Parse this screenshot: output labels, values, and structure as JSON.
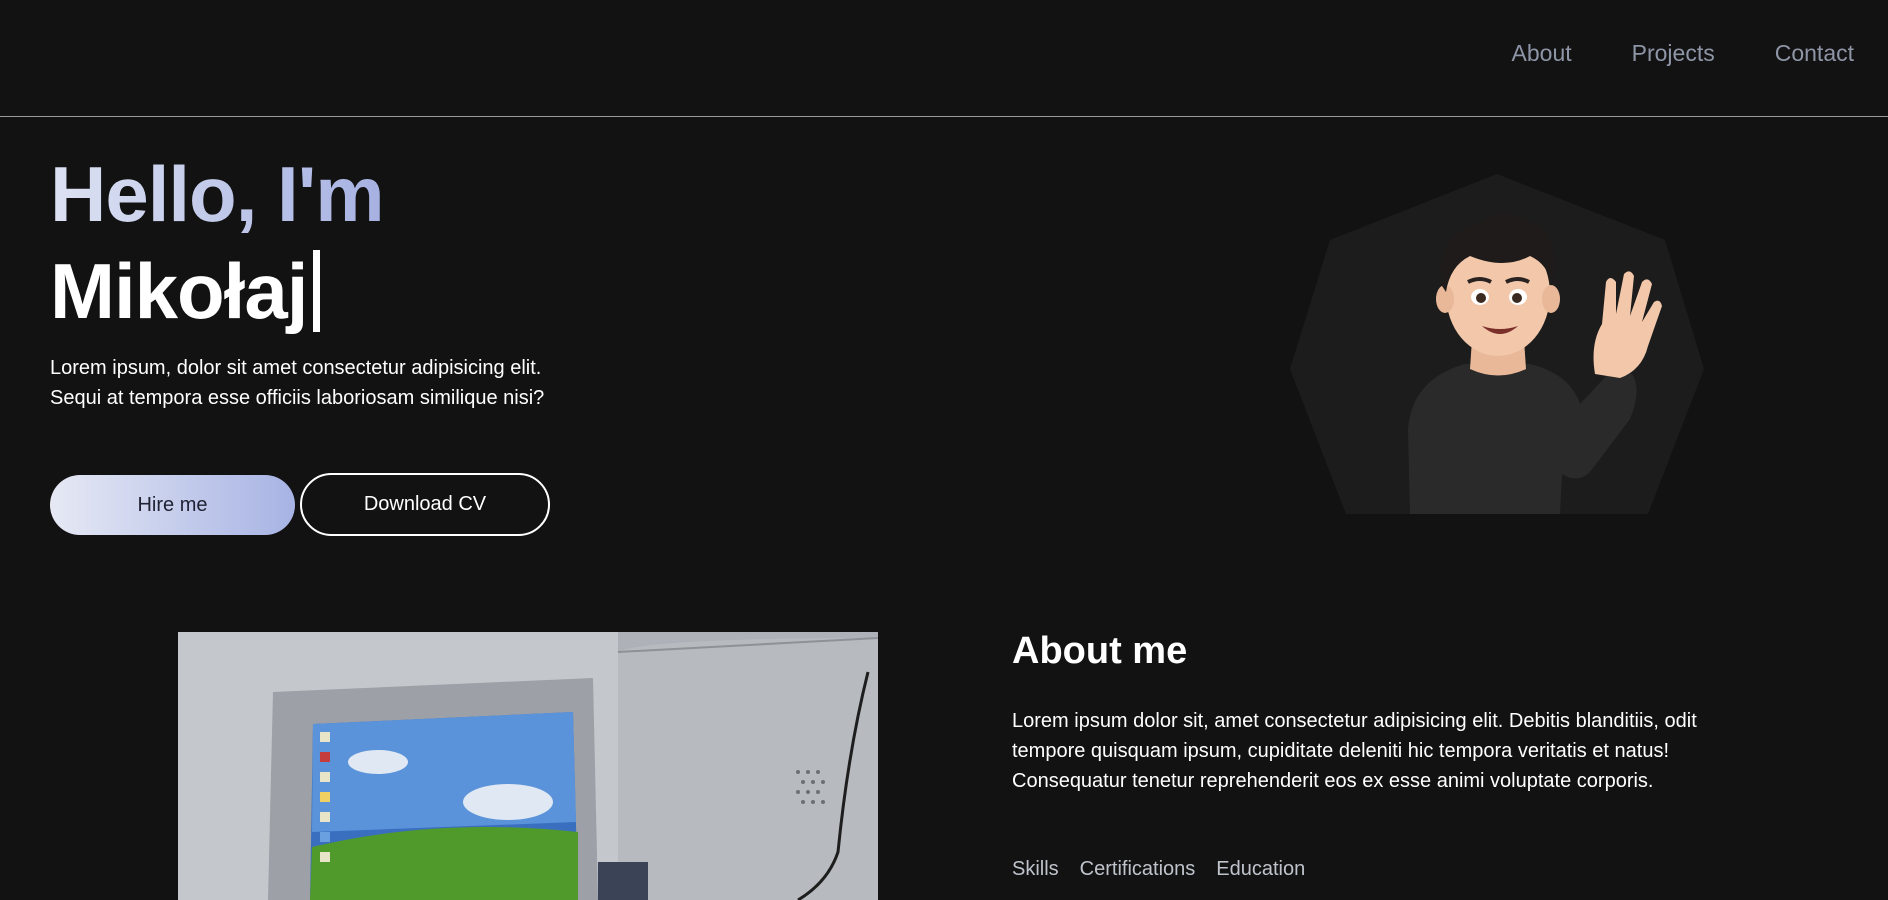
{
  "nav": {
    "items": [
      "About",
      "Projects",
      "Contact"
    ]
  },
  "hero": {
    "greeting": "Hello, I'm",
    "name": "Mikołaj",
    "description": "Lorem ipsum, dolor sit amet consectetur adipisicing elit. Sequi at tempora esse officiis laboriosam similique nisi?",
    "hire_label": "Hire me",
    "cv_label": "Download CV"
  },
  "about": {
    "title": "About me",
    "text": "Lorem ipsum dolor sit, amet consectetur adipisicing elit. Debitis blanditiis, odit tempore quisquam ipsum, cupiditate deleniti hic tempora veritatis et natus! Consequatur tenetur reprehenderit eos ex esse animi voluptate corporis.",
    "tabs": [
      "Skills",
      "Certifications",
      "Education"
    ]
  },
  "colors": {
    "background": "#121212",
    "nav_text": "#8e95a6",
    "accent_gradient_start": "#dde2f2",
    "accent_gradient_end": "#a6b1e2"
  }
}
